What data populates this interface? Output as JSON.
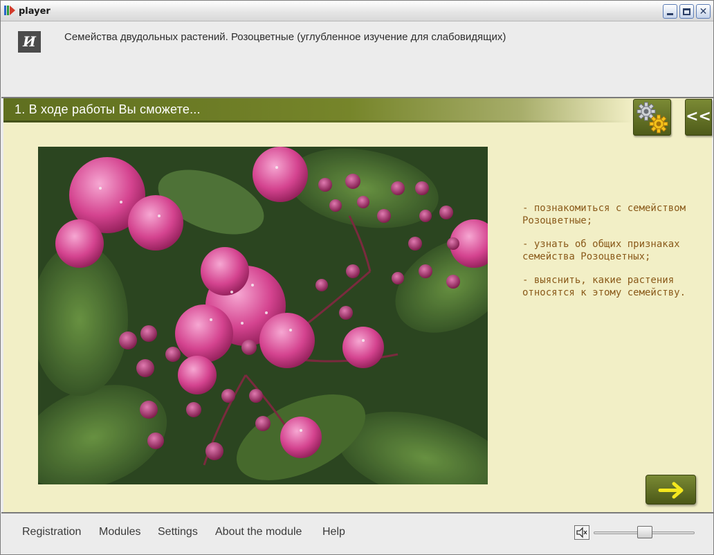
{
  "window": {
    "title": "player",
    "min_glyph": "",
    "close_glyph": "✕"
  },
  "header": {
    "logo_text": "И",
    "course_title": "Семейства двудольных растений. Розоцветные (углубленное изучение для слабовидящих)"
  },
  "section": {
    "title": "1. В ходе работы Вы сможете...",
    "back_label": "<<"
  },
  "content": {
    "bullets": [
      "- познакомиться с семейством Розоцветные;",
      "- узнать об общих признаках семейства Розоцветных;",
      "- выяснить, какие растения относятся к этому семейству."
    ]
  },
  "footer": {
    "nav": [
      "Registration",
      "Modules",
      "Settings",
      "About the module",
      "Help"
    ],
    "volume": 0.5
  },
  "colors": {
    "accent_olive": "#5f6f1f",
    "content_bg": "#f2efc6",
    "bullet_text": "#8a5a1a",
    "arrow_yellow": "#f4e81e"
  },
  "icons": {
    "settings": "gear-icon",
    "back": "double-chevron-left-icon",
    "next": "arrow-right-icon",
    "speaker": "speaker-icon"
  }
}
